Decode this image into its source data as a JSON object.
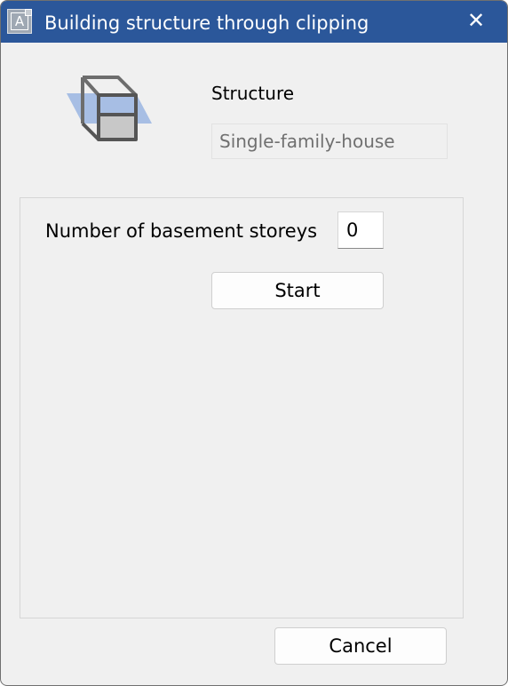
{
  "window": {
    "title": "Building structure through clipping",
    "app_icon_letter": "A",
    "close_glyph": "✕"
  },
  "structure": {
    "label": "Structure",
    "value": "Single-family-house",
    "icon": "building-clipping-icon"
  },
  "basement": {
    "label": "Number of basement storeys",
    "value": "0"
  },
  "buttons": {
    "start": "Start",
    "cancel": "Cancel"
  },
  "colors": {
    "titlebar": "#2b579a",
    "background": "#f0f0f0",
    "clip_plane": "#8faee0"
  }
}
